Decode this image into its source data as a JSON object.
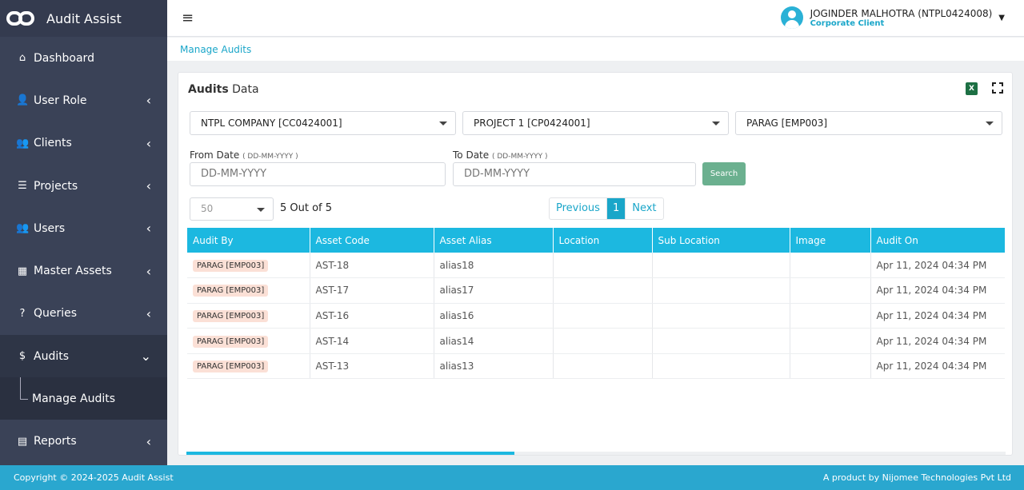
{
  "app": {
    "title": "Audit Assist"
  },
  "sidebar": {
    "items": [
      {
        "label": "Dashboard",
        "icon": "home-icon"
      },
      {
        "label": "User Role",
        "icon": "user-role-icon"
      },
      {
        "label": "Clients",
        "icon": "users-icon"
      },
      {
        "label": "Projects",
        "icon": "list-icon"
      },
      {
        "label": "Users",
        "icon": "users-icon"
      },
      {
        "label": "Master Assets",
        "icon": "building-icon"
      },
      {
        "label": "Queries",
        "icon": "question-icon"
      },
      {
        "label": "Audits",
        "icon": "dollar-icon"
      },
      {
        "label": "Reports",
        "icon": "reports-icon"
      }
    ],
    "sub_item": "Manage Audits"
  },
  "header": {
    "user_name": "JOGINDER MALHOTRA (NTPL0424008)",
    "user_role": "Corporate Client"
  },
  "breadcrumb": "Manage Audits",
  "card": {
    "title_bold": "Audits",
    "title_rest": "Data",
    "excel_label": "X"
  },
  "filters": {
    "company": "NTPL COMPANY [CC0424001]",
    "project": "PROJECT 1 [CP0424001]",
    "employee": "PARAG [EMP003]",
    "from_label": "From Date",
    "from_hint": "( DD-MM-YYYY )",
    "from_placeholder": "DD-MM-YYYY",
    "to_label": "To Date",
    "to_hint": "( DD-MM-YYYY )",
    "to_placeholder": "DD-MM-YYYY",
    "search_label": "Search"
  },
  "pagination": {
    "page_size": "50",
    "count_text": "5 Out of 5",
    "previous": "Previous",
    "current": "1",
    "next": "Next"
  },
  "table": {
    "columns": [
      "Audit By",
      "Asset Code",
      "Asset Alias",
      "Location",
      "Sub Location",
      "Image",
      "Audit On"
    ],
    "rows": [
      [
        "PARAG [EMP003]",
        "AST-18",
        "alias18",
        "",
        "",
        "",
        "Apr 11, 2024 04:34 PM"
      ],
      [
        "PARAG [EMP003]",
        "AST-17",
        "alias17",
        "",
        "",
        "",
        "Apr 11, 2024 04:34 PM"
      ],
      [
        "PARAG [EMP003]",
        "AST-16",
        "alias16",
        "",
        "",
        "",
        "Apr 11, 2024 04:34 PM"
      ],
      [
        "PARAG [EMP003]",
        "AST-14",
        "alias14",
        "",
        "",
        "",
        "Apr 11, 2024 04:34 PM"
      ],
      [
        "PARAG [EMP003]",
        "AST-13",
        "alias13",
        "",
        "",
        "",
        "Apr 11, 2024 04:34 PM"
      ]
    ]
  },
  "footer": {
    "left": "Copyright © 2024-2025 Audit Assist",
    "right": "A product by Nijomee Technologies Pvt Ltd"
  },
  "colors": {
    "sidebar": "#3a4257",
    "accent": "#1cb8e0",
    "search_button": "#6bb08f",
    "badge": "#fbe0d6"
  }
}
